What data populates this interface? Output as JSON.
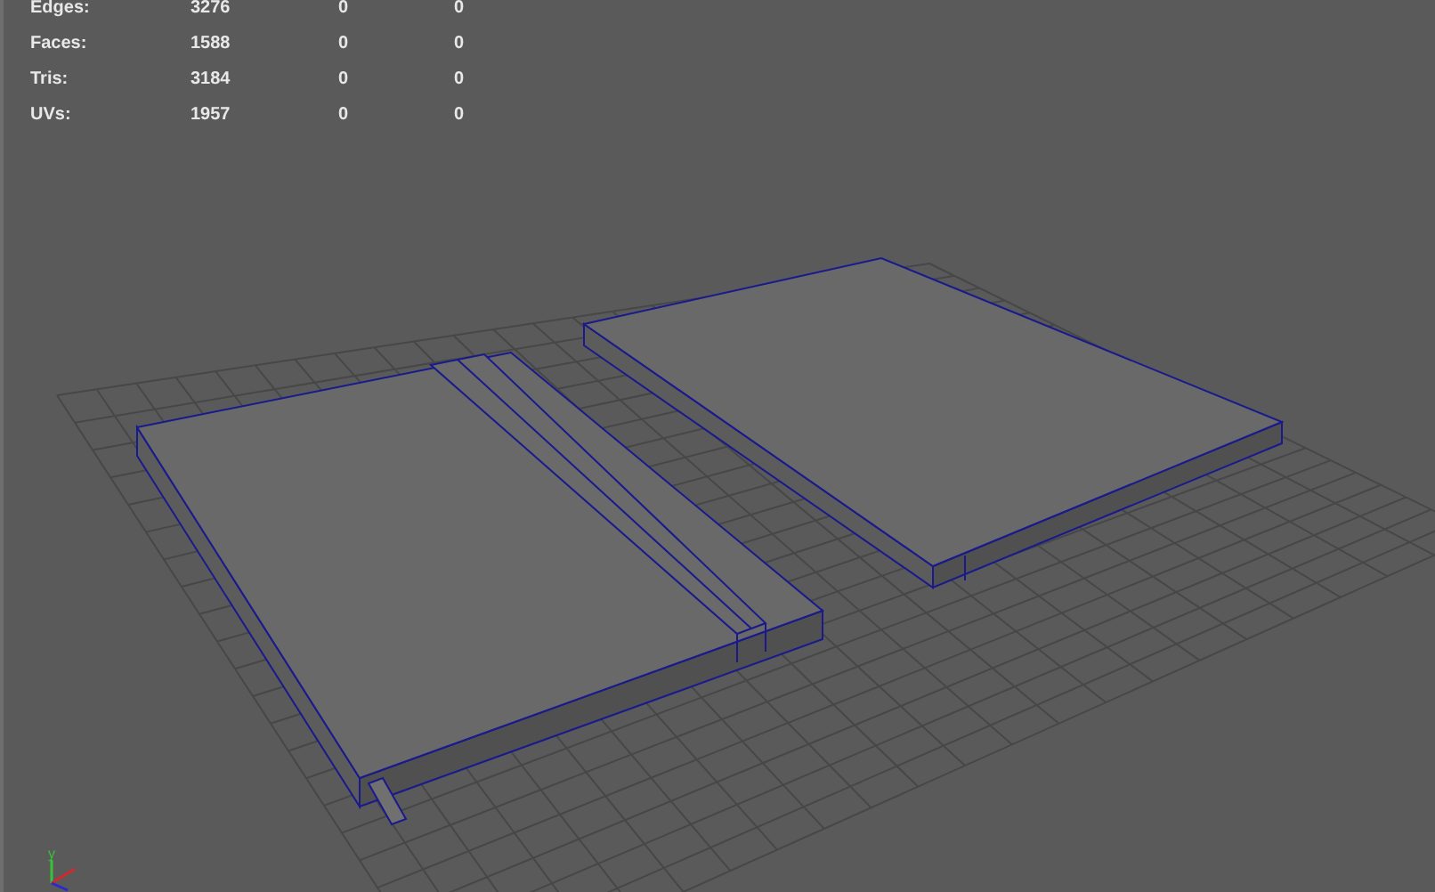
{
  "stats": [
    {
      "label": "Edges:",
      "values": [
        "3276",
        "0",
        "0"
      ]
    },
    {
      "label": "Faces:",
      "values": [
        "1588",
        "0",
        "0"
      ]
    },
    {
      "label": "Tris:",
      "values": [
        "3184",
        "0",
        "0"
      ]
    },
    {
      "label": "UVs:",
      "values": [
        "1957",
        "0",
        "0"
      ]
    }
  ],
  "axis": {
    "label": "y"
  }
}
